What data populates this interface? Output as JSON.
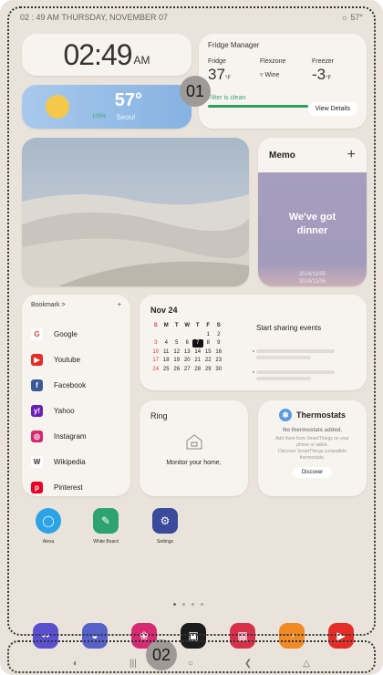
{
  "status_bar": {
    "left": "02 : 49 AM   THURSDAY, NOVEMBER 07",
    "right": "☼ 57°"
  },
  "clock": {
    "time": "02:49",
    "ampm": "AM"
  },
  "weather": {
    "temp": "57°",
    "city": "Seoul"
  },
  "fridge": {
    "title": "Fridge Manager",
    "fridge_label": "Fridge",
    "fridge_value": "37",
    "fridge_unit": "°F",
    "flex_label": "Flexzone",
    "flex_value": "Wine",
    "freezer_label": "Freezer",
    "freezer_value": "-3",
    "freezer_unit": "°F",
    "filter_status": "Filter is clean",
    "filter_percent": "100%",
    "filter_fraction": 1.0,
    "button": "View Details"
  },
  "callouts": {
    "one": "01",
    "two": "02"
  },
  "memo": {
    "title": "Memo",
    "add": "+",
    "line1": "We've got",
    "line2": "dinner",
    "date1": "2024/11/05",
    "date2": "2024/11/05"
  },
  "bookmark": {
    "title": "Bookmark >",
    "add": "+",
    "items": [
      {
        "label": "Google",
        "icon": "google-icon",
        "color": "#ffffff",
        "glyph": "G"
      },
      {
        "label": "Youtube",
        "icon": "youtube-icon",
        "color": "#e52d27",
        "glyph": "▶"
      },
      {
        "label": "Facebook",
        "icon": "facebook-icon",
        "color": "#3b5998",
        "glyph": "f"
      },
      {
        "label": "Yahoo",
        "icon": "yahoo-icon",
        "color": "#6a1fb8",
        "glyph": "y!"
      },
      {
        "label": "Instagram",
        "icon": "instagram-icon",
        "color": "#d6276f",
        "glyph": "◎"
      },
      {
        "label": "Wikipedia",
        "icon": "wikipedia-icon",
        "color": "#ffffff",
        "glyph": "W"
      },
      {
        "label": "Pinterest",
        "icon": "pinterest-icon",
        "color": "#e60023",
        "glyph": "p"
      }
    ]
  },
  "calendar": {
    "month": "Nov 24",
    "headers": [
      "S",
      "M",
      "T",
      "W",
      "T",
      "F",
      "S"
    ],
    "rows": [
      [
        "",
        "",
        "",
        "",
        "",
        "1",
        "2"
      ],
      [
        "3",
        "4",
        "5",
        "6",
        "7",
        "8",
        "9"
      ],
      [
        "10",
        "11",
        "12",
        "13",
        "14",
        "15",
        "16"
      ],
      [
        "17",
        "18",
        "19",
        "20",
        "21",
        "22",
        "23"
      ],
      [
        "24",
        "25",
        "26",
        "27",
        "28",
        "29",
        "30"
      ]
    ],
    "today": "7",
    "share": "Start sharing events"
  },
  "ring": {
    "title": "Ring",
    "message": "Monitor your home,"
  },
  "thermostats": {
    "title": "Thermostats",
    "none": "No thermostats added.",
    "desc1": "Add them from SmartThings on your",
    "desc2": "phone or tablet.",
    "desc3": "Discover SmartThings compatible",
    "desc4": "thermostats.",
    "button": "Discover"
  },
  "apps": [
    {
      "label": "Alexa",
      "color": "#2ba3e5",
      "icon": "alexa-icon"
    },
    {
      "label": "White Board",
      "color": "#2ea36f",
      "icon": "whiteboard-icon"
    },
    {
      "label": "Settings",
      "color": "#3b4a9a",
      "icon": "gear-icon"
    }
  ],
  "dock": [
    {
      "icon": "chat-icon",
      "color": "#5a4fcf"
    },
    {
      "icon": "samsung-internet-icon",
      "color": "#5661c9"
    },
    {
      "icon": "gallery-icon",
      "color": "#d62b72"
    },
    {
      "icon": "tv-icon",
      "color": "#1c1c1c"
    },
    {
      "icon": "store-icon",
      "color": "#d8304a"
    },
    {
      "icon": "cooking-icon",
      "color": "#f08a24"
    },
    {
      "icon": "youtube-icon",
      "color": "#e52d27"
    }
  ]
}
